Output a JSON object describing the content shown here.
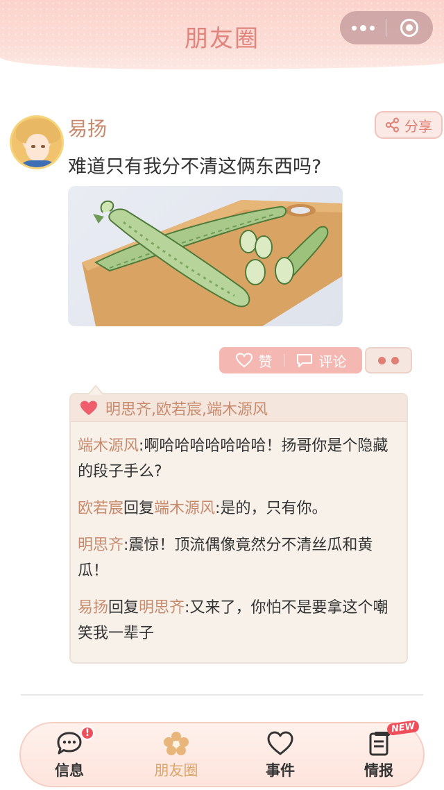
{
  "header": {
    "title": "朋友圈"
  },
  "post": {
    "author": "易扬",
    "share_label": "分享",
    "text": "难道只有我分不清这俩东西吗?",
    "image_icon": "cucumber-illustration"
  },
  "actions": {
    "like_label": "赞",
    "comment_label": "评论"
  },
  "likes": {
    "names": "明思齐,欧若宸,端木源风"
  },
  "comments": [
    {
      "author": "端木源风",
      "reply_word": "",
      "reply_to": "",
      "text": ":啊哈哈哈哈哈哈哈！扬哥你是个隐藏的段子手么?"
    },
    {
      "author": "欧若宸",
      "reply_word": "回复",
      "reply_to": "端木源风",
      "text": ":是的，只有你。"
    },
    {
      "author": "明思齐",
      "reply_word": "",
      "reply_to": "",
      "text": ":震惊！顶流偶像竟然分不清丝瓜和黄瓜！"
    },
    {
      "author": "易扬",
      "reply_word": "回复",
      "reply_to": "明思齐",
      "text": ":又来了，你怕不是要拿这个嘲笑我一辈子"
    }
  ],
  "nav": {
    "items": [
      {
        "label": "信息",
        "icon": "chat-bubble-icon",
        "badge": "!"
      },
      {
        "label": "朋友圈",
        "icon": "flower-icon"
      },
      {
        "label": "事件",
        "icon": "heart-icon"
      },
      {
        "label": "情报",
        "icon": "document-icon",
        "tag": "NEW"
      }
    ]
  },
  "colors": {
    "accent": "#e07f74",
    "name": "#c88a6c",
    "pill": "#f5b7b1"
  }
}
